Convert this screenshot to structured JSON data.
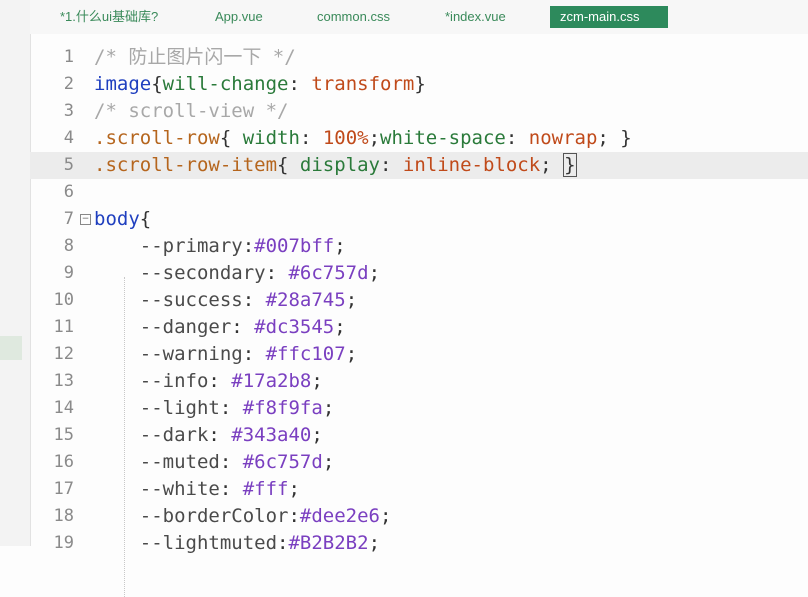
{
  "tabs": [
    {
      "label": "*1.什么ui基础库?",
      "active": false
    },
    {
      "label": "App.vue",
      "active": false
    },
    {
      "label": "common.css",
      "active": false
    },
    {
      "label": "*index.vue",
      "active": false
    },
    {
      "label": "zcm-main.css",
      "active": true
    }
  ],
  "lines": [
    {
      "n": "1",
      "parts": [
        [
          "c-comment",
          "/* 防止图片闪一下 */"
        ]
      ]
    },
    {
      "n": "2",
      "parts": [
        [
          "c-tag",
          "image"
        ],
        [
          "c-punc",
          "{"
        ],
        [
          "c-prop",
          "will-change"
        ],
        [
          "c-punc",
          ": "
        ],
        [
          "c-val",
          "transform"
        ],
        [
          "c-punc",
          "}"
        ]
      ]
    },
    {
      "n": "3",
      "parts": [
        [
          "c-comment",
          "/* scroll-view */"
        ]
      ]
    },
    {
      "n": "4",
      "parts": [
        [
          "c-sel",
          ".scroll-row"
        ],
        [
          "c-punc",
          "{ "
        ],
        [
          "c-prop",
          "width"
        ],
        [
          "c-punc",
          ": "
        ],
        [
          "c-val",
          "100%"
        ],
        [
          "c-punc",
          ";"
        ],
        [
          "c-prop",
          "white-space"
        ],
        [
          "c-punc",
          ": "
        ],
        [
          "c-val",
          "nowrap"
        ],
        [
          "c-punc",
          "; }"
        ]
      ]
    },
    {
      "n": "5",
      "current": true,
      "parts": [
        [
          "c-sel",
          ".scroll-row-item"
        ],
        [
          "c-punc",
          "{ "
        ],
        [
          "c-prop",
          "display"
        ],
        [
          "c-punc",
          ": "
        ],
        [
          "c-val",
          "inline-block"
        ],
        [
          "c-punc",
          "; "
        ],
        [
          "c-punc cursor-box",
          "}"
        ]
      ]
    },
    {
      "n": "6",
      "parts": []
    },
    {
      "n": "7",
      "fold": true,
      "parts": [
        [
          "c-tag",
          "body"
        ],
        [
          "c-punc",
          "{"
        ]
      ]
    },
    {
      "n": "8",
      "parts": [
        [
          "c-var",
          "    --primary"
        ],
        [
          "c-punc",
          ":"
        ],
        [
          "c-hex",
          "#007bff"
        ],
        [
          "c-punc",
          ";"
        ]
      ]
    },
    {
      "n": "9",
      "parts": [
        [
          "c-var",
          "    --secondary"
        ],
        [
          "c-punc",
          ": "
        ],
        [
          "c-hex",
          "#6c757d"
        ],
        [
          "c-punc",
          ";"
        ]
      ]
    },
    {
      "n": "10",
      "parts": [
        [
          "c-var",
          "    --success"
        ],
        [
          "c-punc",
          ": "
        ],
        [
          "c-hex",
          "#28a745"
        ],
        [
          "c-punc",
          ";"
        ]
      ]
    },
    {
      "n": "11",
      "parts": [
        [
          "c-var",
          "    --danger"
        ],
        [
          "c-punc",
          ": "
        ],
        [
          "c-hex",
          "#dc3545"
        ],
        [
          "c-punc",
          ";"
        ]
      ]
    },
    {
      "n": "12",
      "parts": [
        [
          "c-var",
          "    --warning"
        ],
        [
          "c-punc",
          ": "
        ],
        [
          "c-hex",
          "#ffc107"
        ],
        [
          "c-punc",
          ";"
        ]
      ]
    },
    {
      "n": "13",
      "parts": [
        [
          "c-var",
          "    --info"
        ],
        [
          "c-punc",
          ": "
        ],
        [
          "c-hex",
          "#17a2b8"
        ],
        [
          "c-punc",
          ";"
        ]
      ]
    },
    {
      "n": "14",
      "parts": [
        [
          "c-var",
          "    --light"
        ],
        [
          "c-punc",
          ": "
        ],
        [
          "c-hex",
          "#f8f9fa"
        ],
        [
          "c-punc",
          ";"
        ]
      ]
    },
    {
      "n": "15",
      "parts": [
        [
          "c-var",
          "    --dark"
        ],
        [
          "c-punc",
          ": "
        ],
        [
          "c-hex",
          "#343a40"
        ],
        [
          "c-punc",
          ";"
        ]
      ]
    },
    {
      "n": "16",
      "parts": [
        [
          "c-var",
          "    --muted"
        ],
        [
          "c-punc",
          ": "
        ],
        [
          "c-hex",
          "#6c757d"
        ],
        [
          "c-punc",
          ";"
        ]
      ]
    },
    {
      "n": "17",
      "parts": [
        [
          "c-var",
          "    --white"
        ],
        [
          "c-punc",
          ": "
        ],
        [
          "c-hex",
          "#fff"
        ],
        [
          "c-punc",
          ";"
        ]
      ]
    },
    {
      "n": "18",
      "parts": [
        [
          "c-var",
          "    --borderColor"
        ],
        [
          "c-punc",
          ":"
        ],
        [
          "c-hex",
          "#dee2e6"
        ],
        [
          "c-punc",
          ";"
        ]
      ]
    },
    {
      "n": "19",
      "parts": [
        [
          "c-var",
          "    --lightmuted"
        ],
        [
          "c-punc",
          ":"
        ],
        [
          "c-hex",
          "#B2B2B2"
        ],
        [
          "c-punc",
          ";"
        ]
      ]
    }
  ]
}
